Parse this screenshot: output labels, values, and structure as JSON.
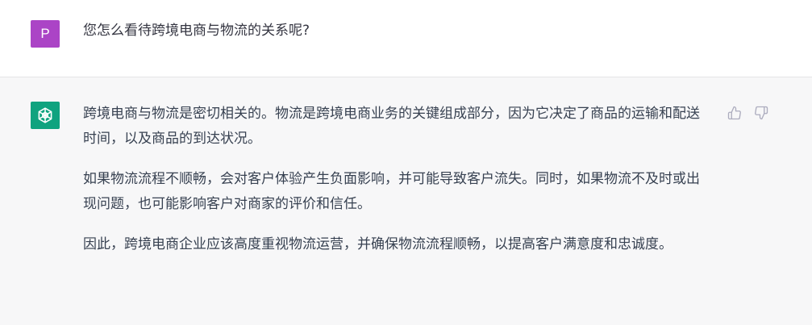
{
  "user": {
    "avatar_letter": "P",
    "message": "您怎么看待跨境电商与物流的关系呢?"
  },
  "assistant": {
    "avatar_icon": "openai-logo-icon",
    "paragraphs": [
      "跨境电商与物流是密切相关的。物流是跨境电商业务的关键组成部分，因为它决定了商品的运输和配送时间，以及商品的到达状况。",
      "如果物流流程不顺畅，会对客户体验产生负面影响，并可能导致客户流失。同时，如果物流不及时或出现问题，也可能影响客户对商家的评价和信任。",
      "因此，跨境电商企业应该高度重视物流运营，并确保物流流程顺畅，以提高客户满意度和忠诚度。"
    ]
  },
  "actions": {
    "thumbs_up_icon": "thumbs-up-icon",
    "thumbs_down_icon": "thumbs-down-icon"
  },
  "colors": {
    "user_avatar": "#ab44c6",
    "bot_avatar": "#10a37f",
    "assistant_bg": "#f7f7f8",
    "text": "#374151"
  }
}
